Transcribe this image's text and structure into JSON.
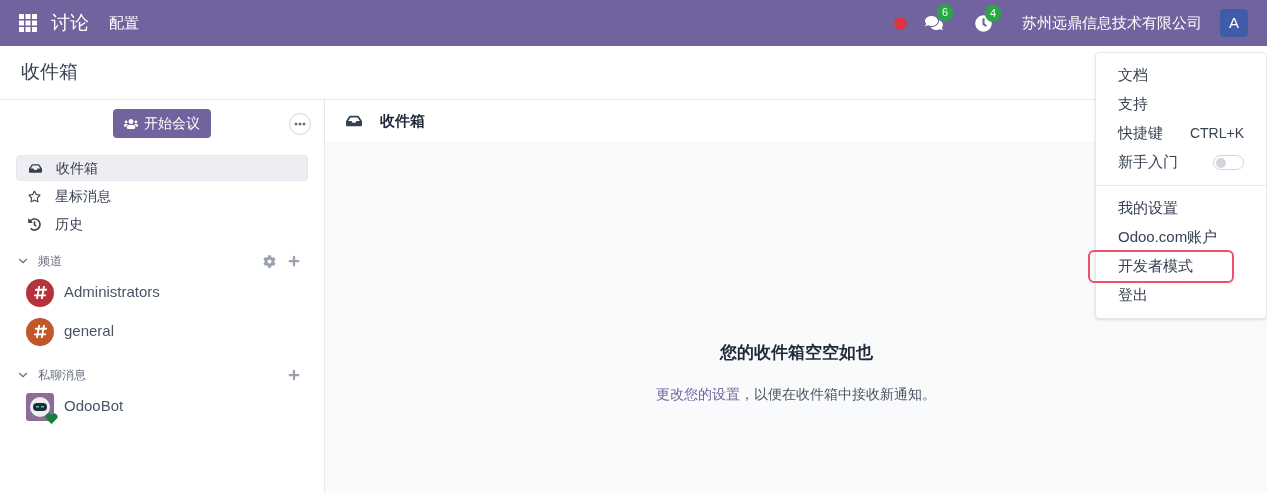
{
  "navbar": {
    "app_name": "讨论",
    "menus": [
      {
        "label": "配置"
      }
    ],
    "messages_badge": "6",
    "activities_badge": "4",
    "company": "苏州远鼎信息技术有限公司",
    "avatar_letter": "A"
  },
  "breadcrumb": "收件箱",
  "sidebar": {
    "start_meeting": "开始会议",
    "mailboxes": [
      {
        "kind": "inbox",
        "label": "收件箱",
        "selected": true
      },
      {
        "kind": "starred",
        "label": "星标消息",
        "selected": false
      },
      {
        "kind": "history",
        "label": "历史",
        "selected": false
      }
    ],
    "channels": {
      "title": "频道",
      "expanded": true,
      "items": [
        {
          "name": "Administrators",
          "color": "#b5343c"
        },
        {
          "name": "general",
          "color": "#c0582c"
        }
      ]
    },
    "direct": {
      "title": "私聊消息",
      "expanded": true,
      "items": [
        {
          "name": "OdooBot",
          "online": true
        }
      ]
    }
  },
  "thread": {
    "title": "收件箱",
    "empty_title": "您的收件箱空空如也",
    "settings_link": "更改您的设置",
    "empty_text": "，以便在收件箱中接收新通知。"
  },
  "user_menu": {
    "items": [
      {
        "kind": "link",
        "label": "文档",
        "highlighted": false
      },
      {
        "kind": "link",
        "label": "支持",
        "highlighted": false
      },
      {
        "kind": "shortcut",
        "label": "快捷键",
        "shortcut": "CTRL+K",
        "highlighted": false
      },
      {
        "kind": "toggle",
        "label": "新手入门",
        "on": false,
        "highlighted": false
      },
      {
        "kind": "divider"
      },
      {
        "kind": "link",
        "label": "我的设置",
        "highlighted": false
      },
      {
        "kind": "link",
        "label": "Odoo.com账户",
        "highlighted": false
      },
      {
        "kind": "link",
        "label": "开发者模式",
        "highlighted": true
      },
      {
        "kind": "link",
        "label": "登出",
        "highlighted": false
      }
    ]
  }
}
